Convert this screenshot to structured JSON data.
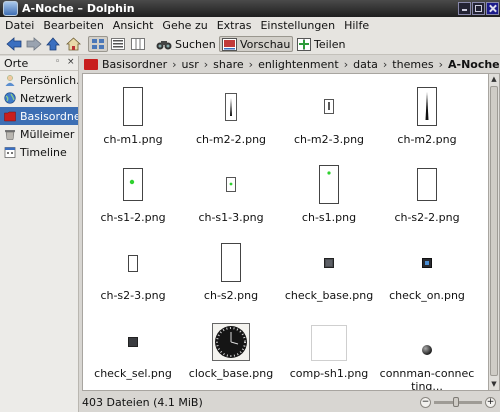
{
  "window": {
    "title": "A-Noche – Dolphin"
  },
  "menubar": [
    "Datei",
    "Bearbeiten",
    "Ansicht",
    "Gehe zu",
    "Extras",
    "Einstellungen",
    "Hilfe"
  ],
  "toolbar": {
    "search_label": "Suchen",
    "preview_label": "Vorschau",
    "split_label": "Teilen"
  },
  "sidebar": {
    "title": "Orte",
    "items": [
      {
        "label": "Persönlich...",
        "icon": "person-icon"
      },
      {
        "label": "Netzwerk",
        "icon": "network-icon"
      },
      {
        "label": "Basisordner",
        "icon": "home-folder-icon",
        "selected": true
      },
      {
        "label": "Mülleimer",
        "icon": "trash-icon"
      },
      {
        "label": "Timeline",
        "icon": "timeline-icon"
      }
    ]
  },
  "breadcrumb": [
    "Basisordner",
    "usr",
    "share",
    "enlightenment",
    "data",
    "themes",
    "A-Noche"
  ],
  "files": [
    {
      "name": "ch-m1.png",
      "thumb": "frame-plain"
    },
    {
      "name": "ch-m2-2.png",
      "thumb": "needle"
    },
    {
      "name": "ch-m2-3.png",
      "thumb": "needle-small"
    },
    {
      "name": "ch-m2.png",
      "thumb": "needle-tall"
    },
    {
      "name": "ch-s1-2.png",
      "thumb": "green-dot"
    },
    {
      "name": "ch-s1-3.png",
      "thumb": "green-dot-small"
    },
    {
      "name": "ch-s1.png",
      "thumb": "green-dot-tall"
    },
    {
      "name": "ch-s2-2.png",
      "thumb": "frame-plain"
    },
    {
      "name": "ch-s2-3.png",
      "thumb": "frame-small"
    },
    {
      "name": "ch-s2.png",
      "thumb": "frame-tall"
    },
    {
      "name": "check_base.png",
      "thumb": "dark-square"
    },
    {
      "name": "check_on.png",
      "thumb": "dark-square-blue"
    },
    {
      "name": "check_sel.png",
      "thumb": "dark-square"
    },
    {
      "name": "clock_base.png",
      "thumb": "clock"
    },
    {
      "name": "comp-sh1.png",
      "thumb": "white-square"
    },
    {
      "name": "connman-connecting...",
      "thumb": "sphere"
    }
  ],
  "status": {
    "text": "403 Dateien (4.1 MiB)",
    "zoom_level": 0.45
  },
  "colors": {
    "selection": "#3d6fb4",
    "home_folder": "#c81e1e",
    "titlebar": "#2a2a2a"
  }
}
